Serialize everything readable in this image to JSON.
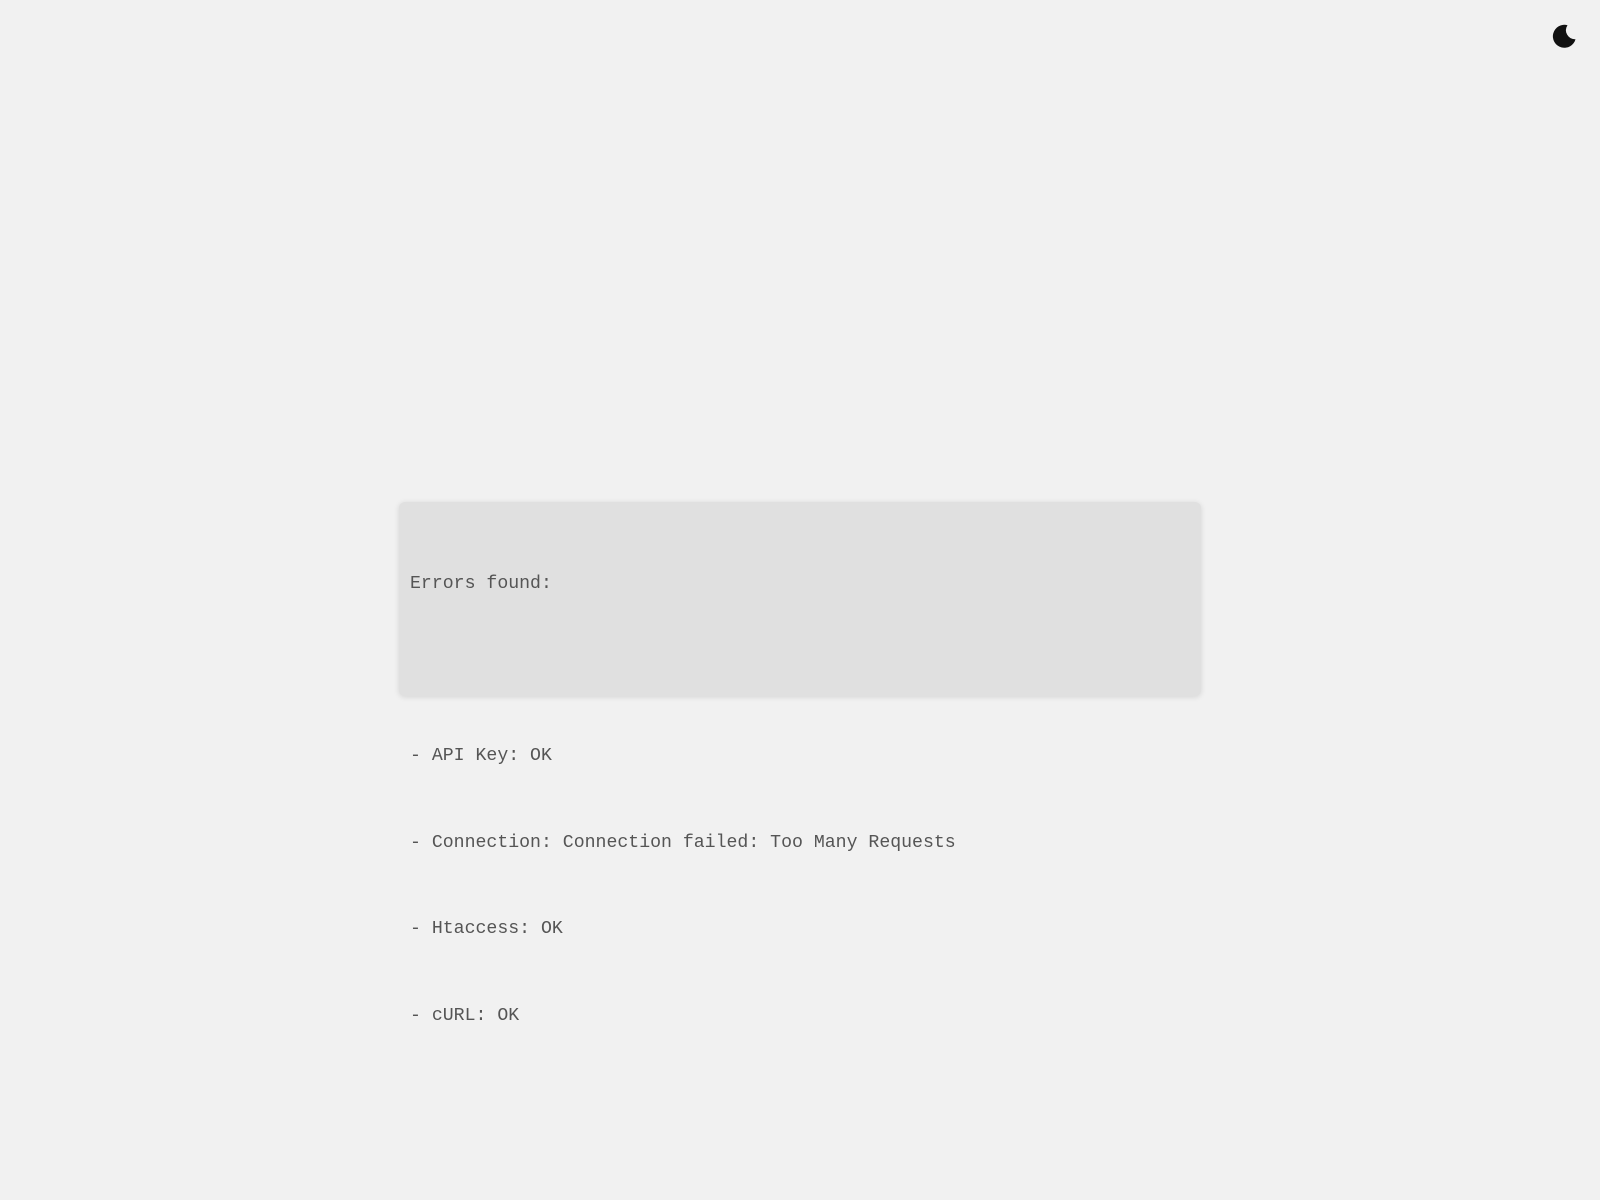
{
  "theme_toggle": {
    "icon": "moon-icon",
    "color": "#111111"
  },
  "errors": {
    "heading": "Errors found:",
    "items": [
      "- API Key: OK",
      "- Connection: Connection failed: Too Many Requests",
      "- Htaccess: OK",
      "- cURL: OK"
    ]
  },
  "colors": {
    "page_background": "#f1f1f1",
    "panel_background": "#e0e0e0",
    "text": "#555555"
  }
}
